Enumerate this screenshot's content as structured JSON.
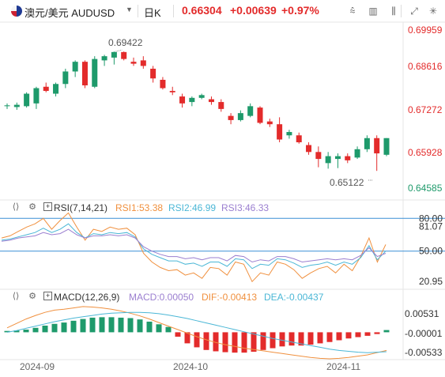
{
  "header": {
    "symbol": "澳元/美元 AUDUSD",
    "timeframe": "日K",
    "price": "0.66304",
    "change": "+0.00639",
    "change_pct": "+0.97%"
  },
  "colors": {
    "up": "#1e9a6b",
    "down": "#e32b2b",
    "rsi1": "#f0903e",
    "rsi2": "#4bb7d6",
    "rsi3": "#9b7fd0",
    "dif": "#f0903e",
    "dea": "#4bb7d6",
    "ref_line": "#3a8fd6"
  },
  "rsi_header": {
    "title": "RSI(7,14,21)",
    "rsi1": "RSI1:53.38",
    "rsi2": "RSI2:46.99",
    "rsi3": "RSI3:46.33"
  },
  "macd_header": {
    "title": "MACD(12,26,9)",
    "macd": "MACD:0.00050",
    "dif": "DIF:-0.00413",
    "dea": "DEA:-0.00437"
  },
  "chart_data": [
    {
      "type": "candlestick",
      "ylim": [
        0.643,
        0.7025
      ],
      "yticks": [
        "0.69959",
        "0.68616",
        "0.67272",
        "0.65928",
        "0.64585"
      ],
      "xticks": [
        "2024-09",
        "2024-10",
        "2024-11"
      ],
      "annotations": [
        "0.69422",
        "0.65122"
      ],
      "candles": [
        {
          "o": 0.6745,
          "h": 0.6755,
          "l": 0.6735,
          "c": 0.6748
        },
        {
          "o": 0.6742,
          "h": 0.6758,
          "l": 0.6732,
          "c": 0.675
        },
        {
          "o": 0.6745,
          "h": 0.6795,
          "l": 0.674,
          "c": 0.679
        },
        {
          "o": 0.6755,
          "h": 0.6815,
          "l": 0.6735,
          "c": 0.681
        },
        {
          "o": 0.6815,
          "h": 0.683,
          "l": 0.6795,
          "c": 0.68
        },
        {
          "o": 0.679,
          "h": 0.683,
          "l": 0.678,
          "c": 0.6825
        },
        {
          "o": 0.6825,
          "h": 0.688,
          "l": 0.681,
          "c": 0.687
        },
        {
          "o": 0.687,
          "h": 0.691,
          "l": 0.685,
          "c": 0.6905
        },
        {
          "o": 0.6905,
          "h": 0.691,
          "l": 0.681,
          "c": 0.682
        },
        {
          "o": 0.6815,
          "h": 0.6925,
          "l": 0.681,
          "c": 0.6915
        },
        {
          "o": 0.691,
          "h": 0.693,
          "l": 0.689,
          "c": 0.6925
        },
        {
          "o": 0.692,
          "h": 0.6942,
          "l": 0.6895,
          "c": 0.694
        },
        {
          "o": 0.694,
          "h": 0.6942,
          "l": 0.691,
          "c": 0.6915
        },
        {
          "o": 0.6905,
          "h": 0.692,
          "l": 0.689,
          "c": 0.6898
        },
        {
          "o": 0.691,
          "h": 0.6925,
          "l": 0.688,
          "c": 0.689
        },
        {
          "o": 0.688,
          "h": 0.689,
          "l": 0.683,
          "c": 0.6845
        },
        {
          "o": 0.684,
          "h": 0.685,
          "l": 0.6805,
          "c": 0.681
        },
        {
          "o": 0.68,
          "h": 0.6815,
          "l": 0.6785,
          "c": 0.6795
        },
        {
          "o": 0.678,
          "h": 0.679,
          "l": 0.674,
          "c": 0.6755
        },
        {
          "o": 0.676,
          "h": 0.678,
          "l": 0.6745,
          "c": 0.6775
        },
        {
          "o": 0.6775,
          "h": 0.679,
          "l": 0.677,
          "c": 0.6785
        },
        {
          "o": 0.677,
          "h": 0.678,
          "l": 0.675,
          "c": 0.676
        },
        {
          "o": 0.676,
          "h": 0.677,
          "l": 0.6725,
          "c": 0.6735
        },
        {
          "o": 0.671,
          "h": 0.672,
          "l": 0.668,
          "c": 0.6695
        },
        {
          "o": 0.6695,
          "h": 0.673,
          "l": 0.669,
          "c": 0.672
        },
        {
          "o": 0.671,
          "h": 0.6755,
          "l": 0.6705,
          "c": 0.6745
        },
        {
          "o": 0.674,
          "h": 0.6745,
          "l": 0.668,
          "c": 0.6685
        },
        {
          "o": 0.669,
          "h": 0.67,
          "l": 0.667,
          "c": 0.668
        },
        {
          "o": 0.668,
          "h": 0.6705,
          "l": 0.6615,
          "c": 0.6625
        },
        {
          "o": 0.664,
          "h": 0.666,
          "l": 0.6628,
          "c": 0.6652
        },
        {
          "o": 0.664,
          "h": 0.665,
          "l": 0.661,
          "c": 0.6615
        },
        {
          "o": 0.6605,
          "h": 0.6615,
          "l": 0.657,
          "c": 0.658
        },
        {
          "o": 0.658,
          "h": 0.66,
          "l": 0.6525,
          "c": 0.6555
        },
        {
          "o": 0.654,
          "h": 0.658,
          "l": 0.652,
          "c": 0.6565
        },
        {
          "o": 0.6555,
          "h": 0.6575,
          "l": 0.6522,
          "c": 0.6565
        },
        {
          "o": 0.6565,
          "h": 0.6575,
          "l": 0.654,
          "c": 0.655
        },
        {
          "o": 0.656,
          "h": 0.66,
          "l": 0.6555,
          "c": 0.659
        },
        {
          "o": 0.659,
          "h": 0.664,
          "l": 0.658,
          "c": 0.663
        },
        {
          "o": 0.663,
          "h": 0.664,
          "l": 0.6512,
          "c": 0.6575
        },
        {
          "o": 0.657,
          "h": 0.663,
          "l": 0.6565,
          "c": 0.663
        }
      ]
    },
    {
      "type": "line",
      "title": "RSI(7,14,21)",
      "ylim": [
        15,
        86
      ],
      "yticks": [
        "80.00",
        "81.07",
        "50.00",
        "20.95"
      ],
      "ref_lines": [
        80,
        50
      ],
      "series": [
        {
          "name": "RSI1",
          "values": [
            62,
            64,
            68,
            72,
            75,
            80,
            70,
            78,
            85,
            72,
            60,
            70,
            68,
            72,
            70,
            71,
            65,
            48,
            40,
            35,
            32,
            33,
            28,
            30,
            25,
            35,
            34,
            28,
            40,
            38,
            22,
            30,
            28,
            40,
            38,
            33,
            25,
            30,
            34,
            36,
            30,
            38,
            32,
            45,
            62,
            40,
            56
          ]
        },
        {
          "name": "RSI2",
          "values": [
            60,
            61,
            63,
            65,
            67,
            71,
            67,
            70,
            75,
            67,
            62,
            66,
            65,
            67,
            66,
            67,
            63,
            52,
            47,
            44,
            41,
            41,
            38,
            39,
            36,
            40,
            40,
            36,
            43,
            42,
            34,
            38,
            37,
            43,
            42,
            39,
            35,
            37,
            38,
            40,
            37,
            40,
            38,
            44,
            55,
            42,
            50
          ]
        },
        {
          "name": "RSI3",
          "values": [
            59,
            60,
            62,
            63,
            64,
            67,
            65,
            66,
            70,
            65,
            62,
            64,
            64,
            65,
            64,
            65,
            62,
            54,
            50,
            47,
            45,
            45,
            43,
            44,
            42,
            44,
            44,
            41,
            46,
            45,
            40,
            42,
            41,
            45,
            45,
            43,
            40,
            41,
            42,
            43,
            42,
            43,
            42,
            46,
            53,
            45,
            48
          ]
        }
      ]
    },
    {
      "type": "bar",
      "title": "MACD(12,26,9)",
      "ylim": [
        -0.006,
        0.0065
      ],
      "yticks": [
        "0.00531",
        "-0.00001",
        "-0.00533"
      ],
      "histogram": [
        0.0003,
        0.0004,
        0.0006,
        0.001,
        0.0015,
        0.0019,
        0.0022,
        0.0026,
        0.003,
        0.0033,
        0.0034,
        0.0034,
        0.0033,
        0.0032,
        0.0029,
        0.0024,
        0.0018,
        0.0012,
        -0.001,
        -0.0025,
        -0.0034,
        -0.004,
        -0.0043,
        -0.0045,
        -0.0046,
        -0.0046,
        -0.0044,
        -0.004,
        -0.0036,
        -0.0032,
        -0.003,
        -0.003,
        -0.0028,
        -0.0025,
        -0.0022,
        -0.0018,
        -0.0014,
        -0.0011,
        -0.0008,
        -0.0004,
        0.0005
      ],
      "series": [
        {
          "name": "DIF",
          "values": [
            0.001,
            0.002,
            0.003,
            0.0038,
            0.0045,
            0.005,
            0.0052,
            0.0055,
            0.0058,
            0.0057,
            0.0055,
            0.0052,
            0.0048,
            0.0043,
            0.0037,
            0.003,
            0.0022,
            0.0014,
            0.0006,
            -0.0002,
            -0.001,
            -0.0017,
            -0.0023,
            -0.0028,
            -0.0032,
            -0.0036,
            -0.0039,
            -0.0042,
            -0.0045,
            -0.0048,
            -0.0051,
            -0.0054,
            -0.0057,
            -0.0059,
            -0.006,
            -0.0059,
            -0.0057,
            -0.0054,
            -0.0051,
            -0.0046,
            -0.0041
          ]
        },
        {
          "name": "DEA",
          "values": [
            0.0,
            0.0004,
            0.0009,
            0.0014,
            0.0019,
            0.0024,
            0.0028,
            0.0032,
            0.0035,
            0.0038,
            0.0041,
            0.0043,
            0.0044,
            0.0045,
            0.0045,
            0.0044,
            0.0042,
            0.0039,
            0.0035,
            0.0031,
            0.0026,
            0.0021,
            0.0016,
            0.0011,
            0.0006,
            0.0001,
            -0.0004,
            -0.0009,
            -0.0014,
            -0.0018,
            -0.0022,
            -0.0026,
            -0.003,
            -0.0034,
            -0.0038,
            -0.0041,
            -0.0043,
            -0.0045,
            -0.0046,
            -0.0045,
            -0.0044
          ]
        }
      ]
    }
  ]
}
